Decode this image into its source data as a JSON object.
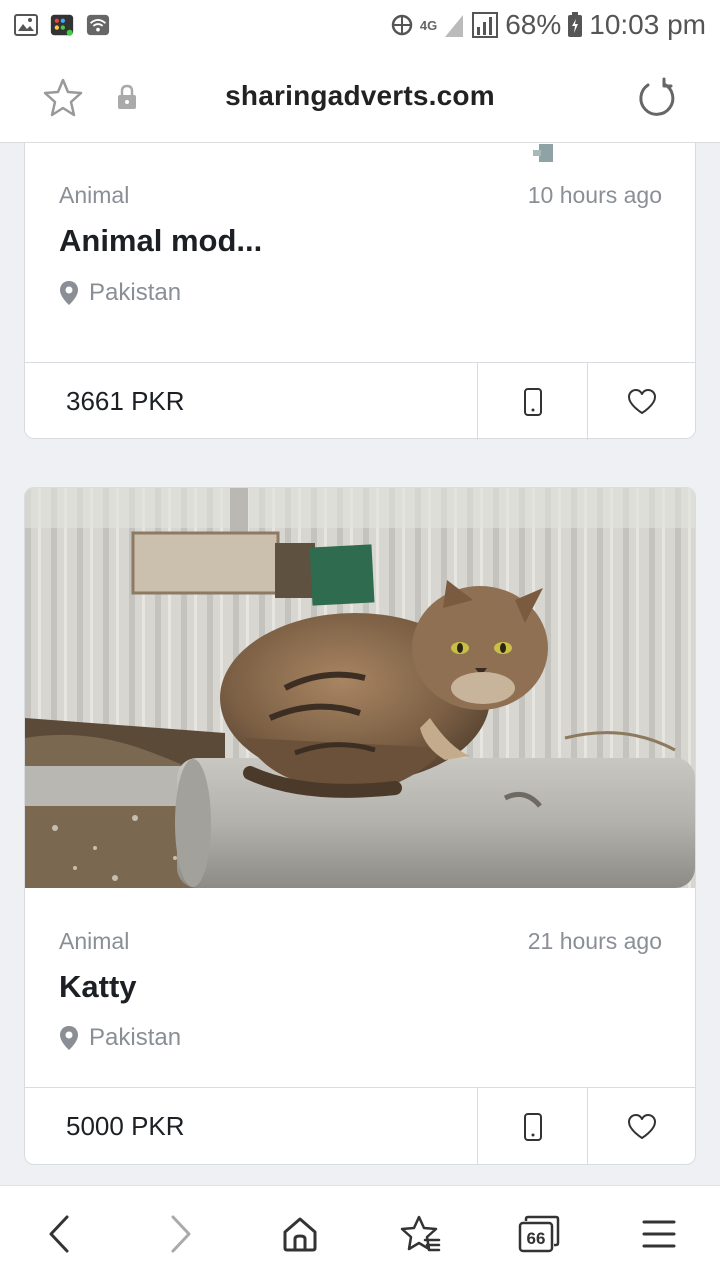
{
  "status_bar": {
    "network": "4G",
    "battery": "68%",
    "time": "10:03 pm"
  },
  "address_bar": {
    "url": "sharingadverts.com"
  },
  "listings": [
    {
      "category": "Animal",
      "time_ago": "10 hours ago",
      "title": "Animal mod...",
      "location": "Pakistan",
      "price": "3661 PKR"
    },
    {
      "category": "Animal",
      "time_ago": "21 hours ago",
      "title": "Katty",
      "location": "Pakistan",
      "price": "5000 PKR"
    }
  ],
  "bottom_nav": {
    "tabs_count": "66"
  },
  "colors": {
    "background": "#eef0f4",
    "card": "#ffffff",
    "muted_text": "#8a8f96",
    "title_text": "#1c1f24",
    "border": "#d8dbe0"
  },
  "icons": [
    "gallery-icon",
    "app-icon",
    "wifi-icon",
    "data-saver-icon",
    "signal-icon",
    "battery-icon",
    "star-icon",
    "lock-icon",
    "reload-icon",
    "location-pin-icon",
    "phone-icon",
    "heart-icon",
    "back-icon",
    "forward-icon",
    "home-icon",
    "bookmarks-icon",
    "tabs-icon",
    "menu-icon"
  ]
}
